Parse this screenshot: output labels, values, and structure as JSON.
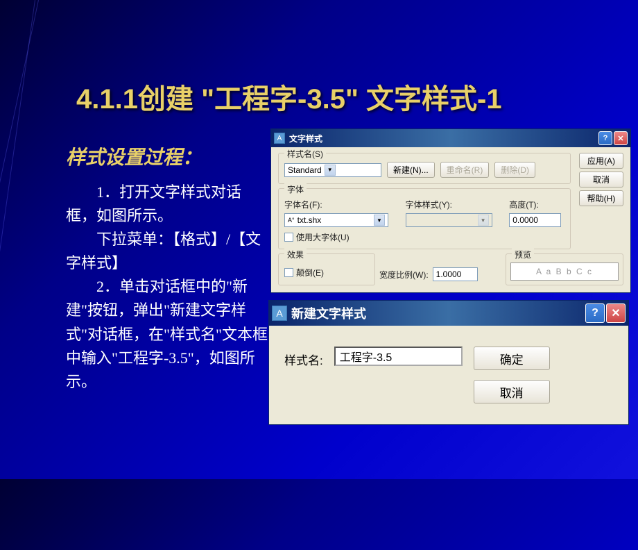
{
  "slide": {
    "title": "4.1.1创建 \"工程字-3.5\" 文字样式-1",
    "subtitle": "样式设置过程：",
    "para1": "1．打开文字样式对话框，如图所示。",
    "para2": "下拉菜单：【格式】/【文字样式】",
    "para3": "2．单击对话框中的\"新建\"按钮，弹出\"新建文字样式\"对话框，在\"样式名\"文本框中输入\"工程字-3.5\"，如图所示。"
  },
  "dialog_main": {
    "title": "文字样式",
    "groups": {
      "style_name": "样式名(S)",
      "font": "字体",
      "effects": "效果",
      "preview": "预览"
    },
    "style_combo": "Standard",
    "buttons": {
      "new": "新建(N)...",
      "rename": "重命名(R)",
      "delete": "删除(D)",
      "apply": "应用(A)",
      "cancel": "取消",
      "help": "帮助(H)"
    },
    "font": {
      "name_label": "字体名(F):",
      "name_value": "txt.shx",
      "style_label": "字体样式(Y):",
      "height_label": "高度(T):",
      "height_value": "0.0000",
      "bigfont_label": "使用大字体(U)"
    },
    "effects": {
      "upside_label": "颠倒(E)"
    },
    "width": {
      "label": "宽度比例(W):",
      "value": "1.0000"
    },
    "preview_text": "A a B b C c"
  },
  "dialog_new": {
    "title": "新建文字样式",
    "label": "样式名:",
    "value": "工程字-3.5",
    "ok": "确定",
    "cancel": "取消"
  }
}
